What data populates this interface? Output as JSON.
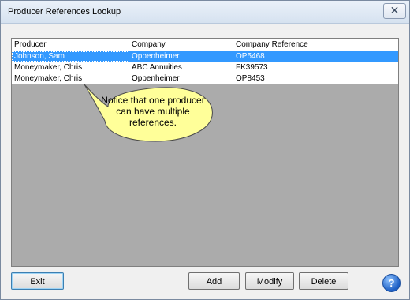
{
  "window": {
    "title": "Producer References Lookup",
    "close_glyph": "✕"
  },
  "grid": {
    "columns": [
      "Producer",
      "Company",
      "Company Reference"
    ],
    "rows": [
      {
        "producer": "Johnson, Sam",
        "company": "Oppenheimer",
        "reference": "OP5468",
        "selected": true
      },
      {
        "producer": "Moneymaker, Chris",
        "company": "ABC Annuities",
        "reference": "FK39573",
        "selected": false
      },
      {
        "producer": "Moneymaker, Chris",
        "company": "Oppenheimer",
        "reference": "OP8453",
        "selected": false
      }
    ]
  },
  "callout": {
    "text": "Notice that one producer can have multiple references."
  },
  "buttons": {
    "exit": "Exit",
    "add": "Add",
    "modify": "Modify",
    "delete": "Delete",
    "help": "?"
  },
  "colors": {
    "selection": "#3399ff",
    "grid_background": "#ababab",
    "callout_fill": "#ffff99"
  },
  "icons": {
    "close": "close-icon",
    "help": "help-icon"
  }
}
